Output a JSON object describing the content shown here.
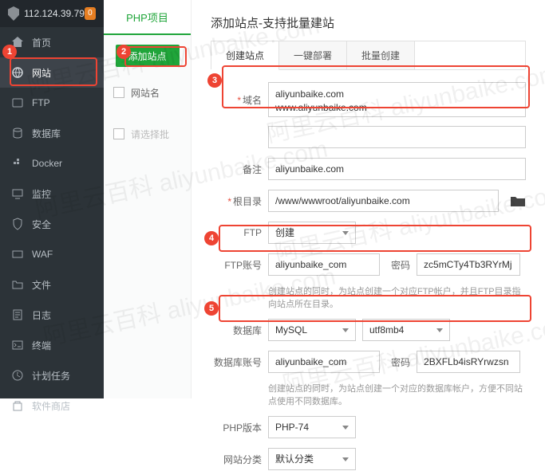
{
  "ip": "112.124.39.79",
  "notif_count": "0",
  "sidebar": {
    "items": [
      {
        "label": "首页"
      },
      {
        "label": "网站"
      },
      {
        "label": "FTP"
      },
      {
        "label": "数据库"
      },
      {
        "label": "Docker"
      },
      {
        "label": "监控"
      },
      {
        "label": "安全"
      },
      {
        "label": "WAF"
      },
      {
        "label": "文件"
      },
      {
        "label": "日志"
      },
      {
        "label": "终端"
      },
      {
        "label": "计划任务"
      },
      {
        "label": "软件商店"
      }
    ]
  },
  "panel": {
    "tab": "PHP项目",
    "add_btn": "添加站点",
    "col_name": "网站名",
    "placeholder": "请选择批"
  },
  "modal": {
    "title": "添加站点-支持批量建站",
    "tabs": [
      "创建站点",
      "一键部署",
      "批量创建"
    ],
    "labels": {
      "domain": "域名",
      "remark": "备注",
      "root": "根目录",
      "ftp": "FTP",
      "ftp_acc": "FTP账号",
      "pwd": "密码",
      "db": "数据库",
      "db_acc": "数据库账号",
      "php_ver": "PHP版本",
      "site_cat": "网站分类"
    },
    "values": {
      "domain": "aliyunbaike.com\nwww.aliyunbaike.com",
      "remark": "aliyunbaike.com",
      "root": "/www/wwwroot/aliyunbaike.com",
      "ftp_sel": "创建",
      "ftp_acc": "aliyunbaike_com",
      "ftp_pwd": "zc5mCTy4Tb3RYrMj",
      "db_sel": "MySQL",
      "db_charset": "utf8mb4",
      "db_acc": "aliyunbaike_com",
      "db_pwd": "2BXFLb4isRYrwzsn",
      "php_ver": "PHP-74",
      "site_cat": "默认分类"
    },
    "hints": {
      "ftp": "创建站点的同时，为站点创建一个对应FTP帐户，并且FTP目录指向站点所在目录。",
      "db": "创建站点的同时，为站点创建一个对应的数据库帐户，方便不同站点使用不同数据库。"
    }
  },
  "watermark": "阿里云百科 aliyunbaike.com"
}
